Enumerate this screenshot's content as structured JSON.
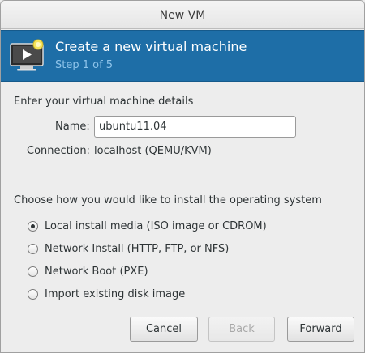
{
  "window": {
    "title": "New VM"
  },
  "banner": {
    "title": "Create a new virtual machine",
    "step": "Step 1 of 5",
    "icon": "monitor-play-icon",
    "bg_color": "#1e6ea7"
  },
  "details": {
    "heading": "Enter your virtual machine details",
    "name_label": "Name:",
    "name_value": "ubuntu11.04",
    "connection_label": "Connection:",
    "connection_value": "localhost (QEMU/KVM)"
  },
  "install": {
    "heading": "Choose how you would like to install the operating system",
    "options": [
      {
        "label": "Local install media (ISO image or CDROM)",
        "checked": true
      },
      {
        "label": "Network Install (HTTP, FTP, or NFS)",
        "checked": false
      },
      {
        "label": "Network Boot (PXE)",
        "checked": false
      },
      {
        "label": "Import existing disk image",
        "checked": false
      }
    ]
  },
  "buttons": {
    "cancel": "Cancel",
    "back": "Back",
    "forward": "Forward"
  }
}
